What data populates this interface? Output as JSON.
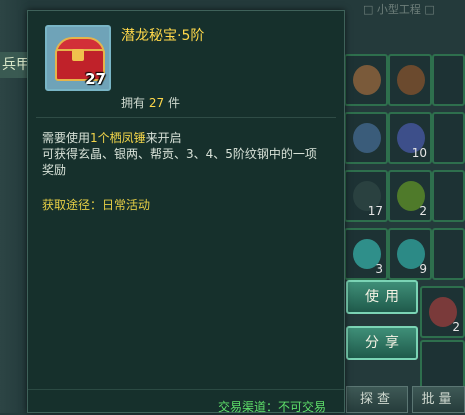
{
  "tooltip": {
    "item_name": "潜龙秘宝·5阶",
    "icon_quantity": "27",
    "own_prefix": "拥有",
    "own_count": "27",
    "own_suffix": "件",
    "desc_line1_a": "需要使用",
    "desc_line1_hl": "1个栖凤锤",
    "desc_line1_b": "来开启",
    "desc_line2": "可获得玄晶、银两、帮贡、3、4、5阶纹钢中的一项",
    "desc_line3": "奖励",
    "source": "获取途径：日常活动",
    "trade": "交易渠道：不可交易"
  },
  "background": {
    "side_tab": "兵甲",
    "top_right_text": "□ 小型工程 □",
    "use_button": "使用",
    "share_button": "分享",
    "bottom_buttons": [
      "探查",
      "批量"
    ],
    "cell_quantities": [
      "10",
      "17",
      "2",
      "3",
      "9",
      "2"
    ]
  },
  "colors": {
    "title": "#ffd84a",
    "highlight": "#f1d44a",
    "trade": "#5ee06a",
    "button": "#3f8f78"
  }
}
